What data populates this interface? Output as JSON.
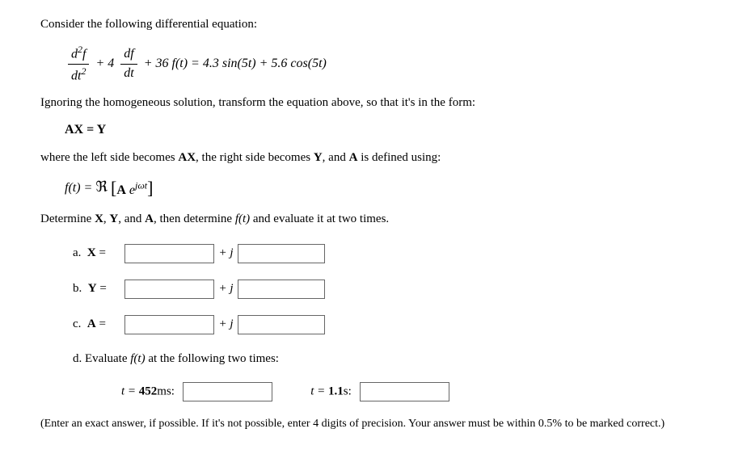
{
  "intro": "Consider the following differential equation:",
  "eq": {
    "d2f": "d",
    "sup2": "2",
    "f": "f",
    "dt2": "dt",
    "plus": " +  ",
    "coef1": "4",
    "df": "df",
    "dt": "dt",
    "coef2": "36",
    "ft": "f(t)",
    "eq_sign": "  =  ",
    "rhs1": "4.3 sin(5",
    "rhs_t1": "t",
    "rhs2": ")  +  5.6 cos(5",
    "rhs_t2": "t",
    "rhs3": ")"
  },
  "line2": "Ignoring the homogeneous solution, transform the equation above, so that it's in the form:",
  "axy": "AX = Y",
  "line3a": "where the left side becomes ",
  "line3b": ", the right side becomes ",
  "line3c": ", and ",
  "line3d": " is defined using:",
  "AX": "AX",
  "Y": "Y",
  "A": "A",
  "ftdef": {
    "lhs": "f(t)  =  ",
    "re": "ℜ",
    "lb": "[",
    "A": "A",
    "e": " e",
    "exp": "jωt",
    "rb": "]"
  },
  "line4a": "Determine ",
  "line4b": ", ",
  "line4c": ", and ",
  "line4d": ", then determine ",
  "line4e": " and evaluate it at two times.",
  "X": "X",
  "ft_ital": "f(t)",
  "parts": {
    "a": "a.",
    "b": "b.",
    "c": "c.",
    "d": "d."
  },
  "vars": {
    "X": "X",
    "Y": "Y",
    "A": "A"
  },
  "eqsign": " =",
  "plusj": "+ j",
  "partd_text": " Evaluate ",
  "partd_text2": " at the following two times:",
  "t_eq": "t = ",
  "t1_val": "452",
  "t1_unit": "ms:",
  "t2_val": "1.1",
  "t2_unit": "s:",
  "note": "(Enter an exact answer, if possible. If it's not possible, enter 4 digits of precision. Your answer must be within 0.5% to be marked correct.)"
}
